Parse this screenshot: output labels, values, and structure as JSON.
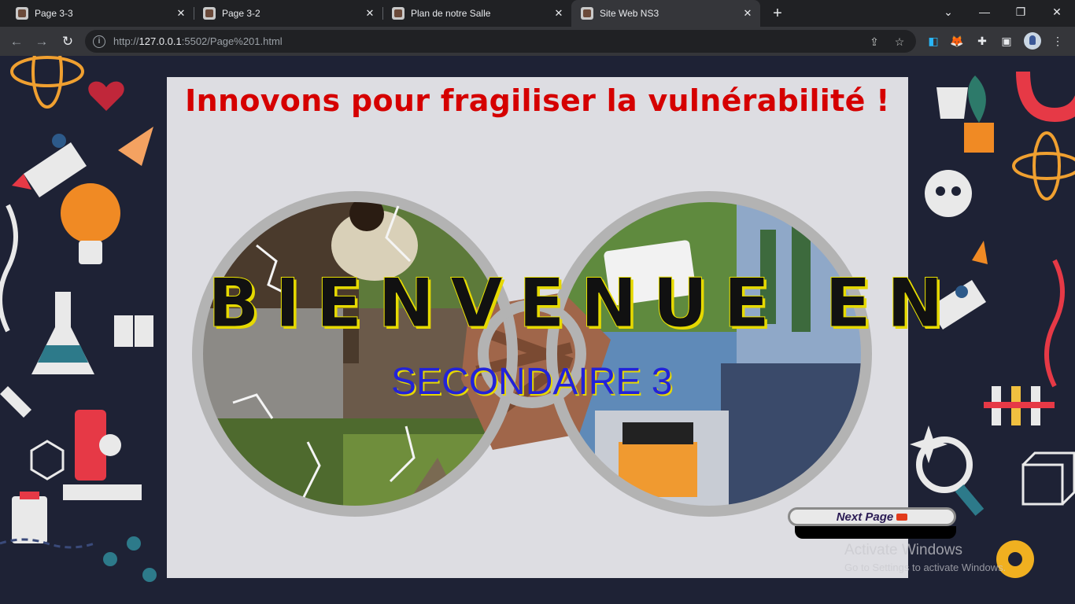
{
  "tabs": [
    {
      "label": "Page 3-3",
      "active": false
    },
    {
      "label": "Page 3-2",
      "active": false
    },
    {
      "label": "Plan de notre Salle",
      "active": false
    },
    {
      "label": "Site Web NS3",
      "active": true
    }
  ],
  "address": {
    "prefix": "http://",
    "host": "127.0.0.1",
    "rest": ":5502/Page%201.html"
  },
  "page": {
    "slogan": "Innovons pour fragiliser la vulnérabilité !",
    "welcome": "BIENVENUE EN",
    "subtitle": "SECONDAIRE 3",
    "next_button": "Next Page"
  },
  "watermark": {
    "title": "Activate Windows",
    "subtitle": "Go to Settings to activate Windows."
  },
  "colors": {
    "slogan": "#d50000",
    "subtitle": "#2323d8",
    "page_bg": "#1e2235",
    "chrome_dark": "#202124",
    "chrome_toolbar": "#35363a"
  }
}
